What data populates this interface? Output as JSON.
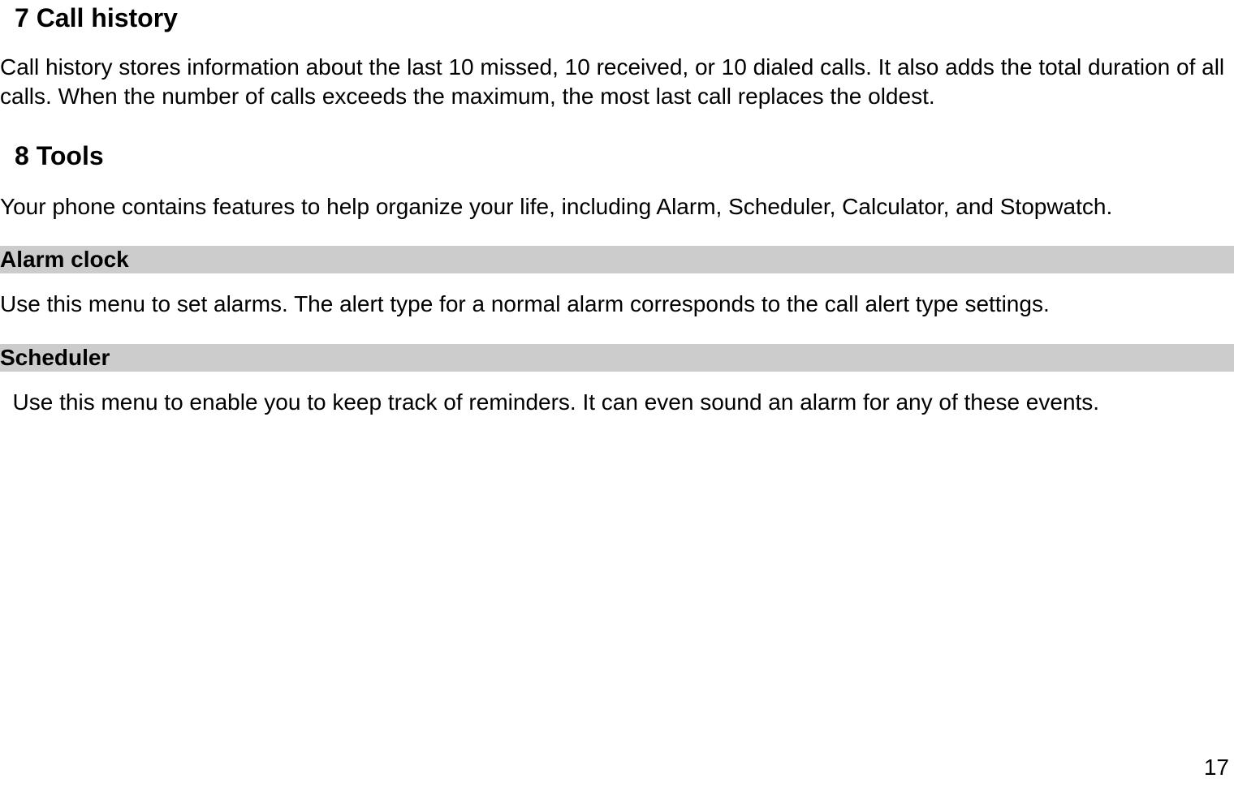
{
  "sections": {
    "callHistory": {
      "title": "7 Call history",
      "body": "Call history stores information about the last 10 missed, 10 received, or 10 dialed calls. It also adds the total duration of all calls. When the number of calls exceeds the maximum, the most last call replaces the oldest."
    },
    "tools": {
      "title": "8 Tools",
      "intro": "Your phone contains features to help organize your life, including Alarm, Scheduler, Calculator, and Stopwatch.",
      "alarm": {
        "heading": "Alarm clock",
        "body": "Use this menu to set alarms. The alert type for a normal alarm corresponds to the call alert type settings."
      },
      "scheduler": {
        "heading": "Scheduler",
        "body": "  Use this menu to enable you to keep track of reminders. It can even sound an alarm for any of these events."
      }
    }
  },
  "pageNumber": "17"
}
